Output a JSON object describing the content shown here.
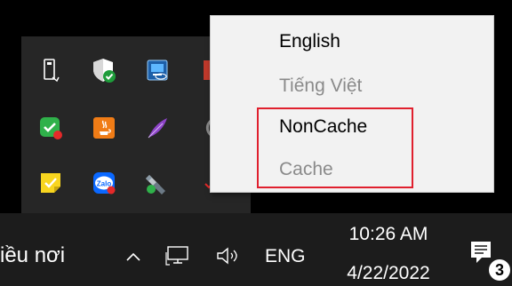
{
  "language_menu": {
    "items": [
      {
        "label": "English",
        "state": "active"
      },
      {
        "label": "Tiếng Việt",
        "state": "disabled"
      },
      {
        "label": "NonCache",
        "state": "active"
      },
      {
        "label": "Cache",
        "state": "disabled"
      }
    ]
  },
  "tray_flyout": {
    "icons": [
      "usb-drive-icon",
      "windows-security-icon",
      "intel-graphics-icon",
      "green-check-icon",
      "java-icon",
      "feather-icon",
      "sticky-notes-icon",
      "zalo-icon",
      "usb-eject-icon"
    ],
    "zalo_label": "Zalo"
  },
  "taskbar": {
    "search_text": "iều nơi",
    "input_indicator": "ENG",
    "clock": {
      "time": "10:26 AM",
      "date": "4/22/2022"
    },
    "notification_count": "3"
  },
  "colors": {
    "highlight": "#e0202e",
    "menu_bg": "#f2f2f2",
    "taskbar_bg": "#1c1c1c",
    "flyout_bg": "#262626"
  }
}
